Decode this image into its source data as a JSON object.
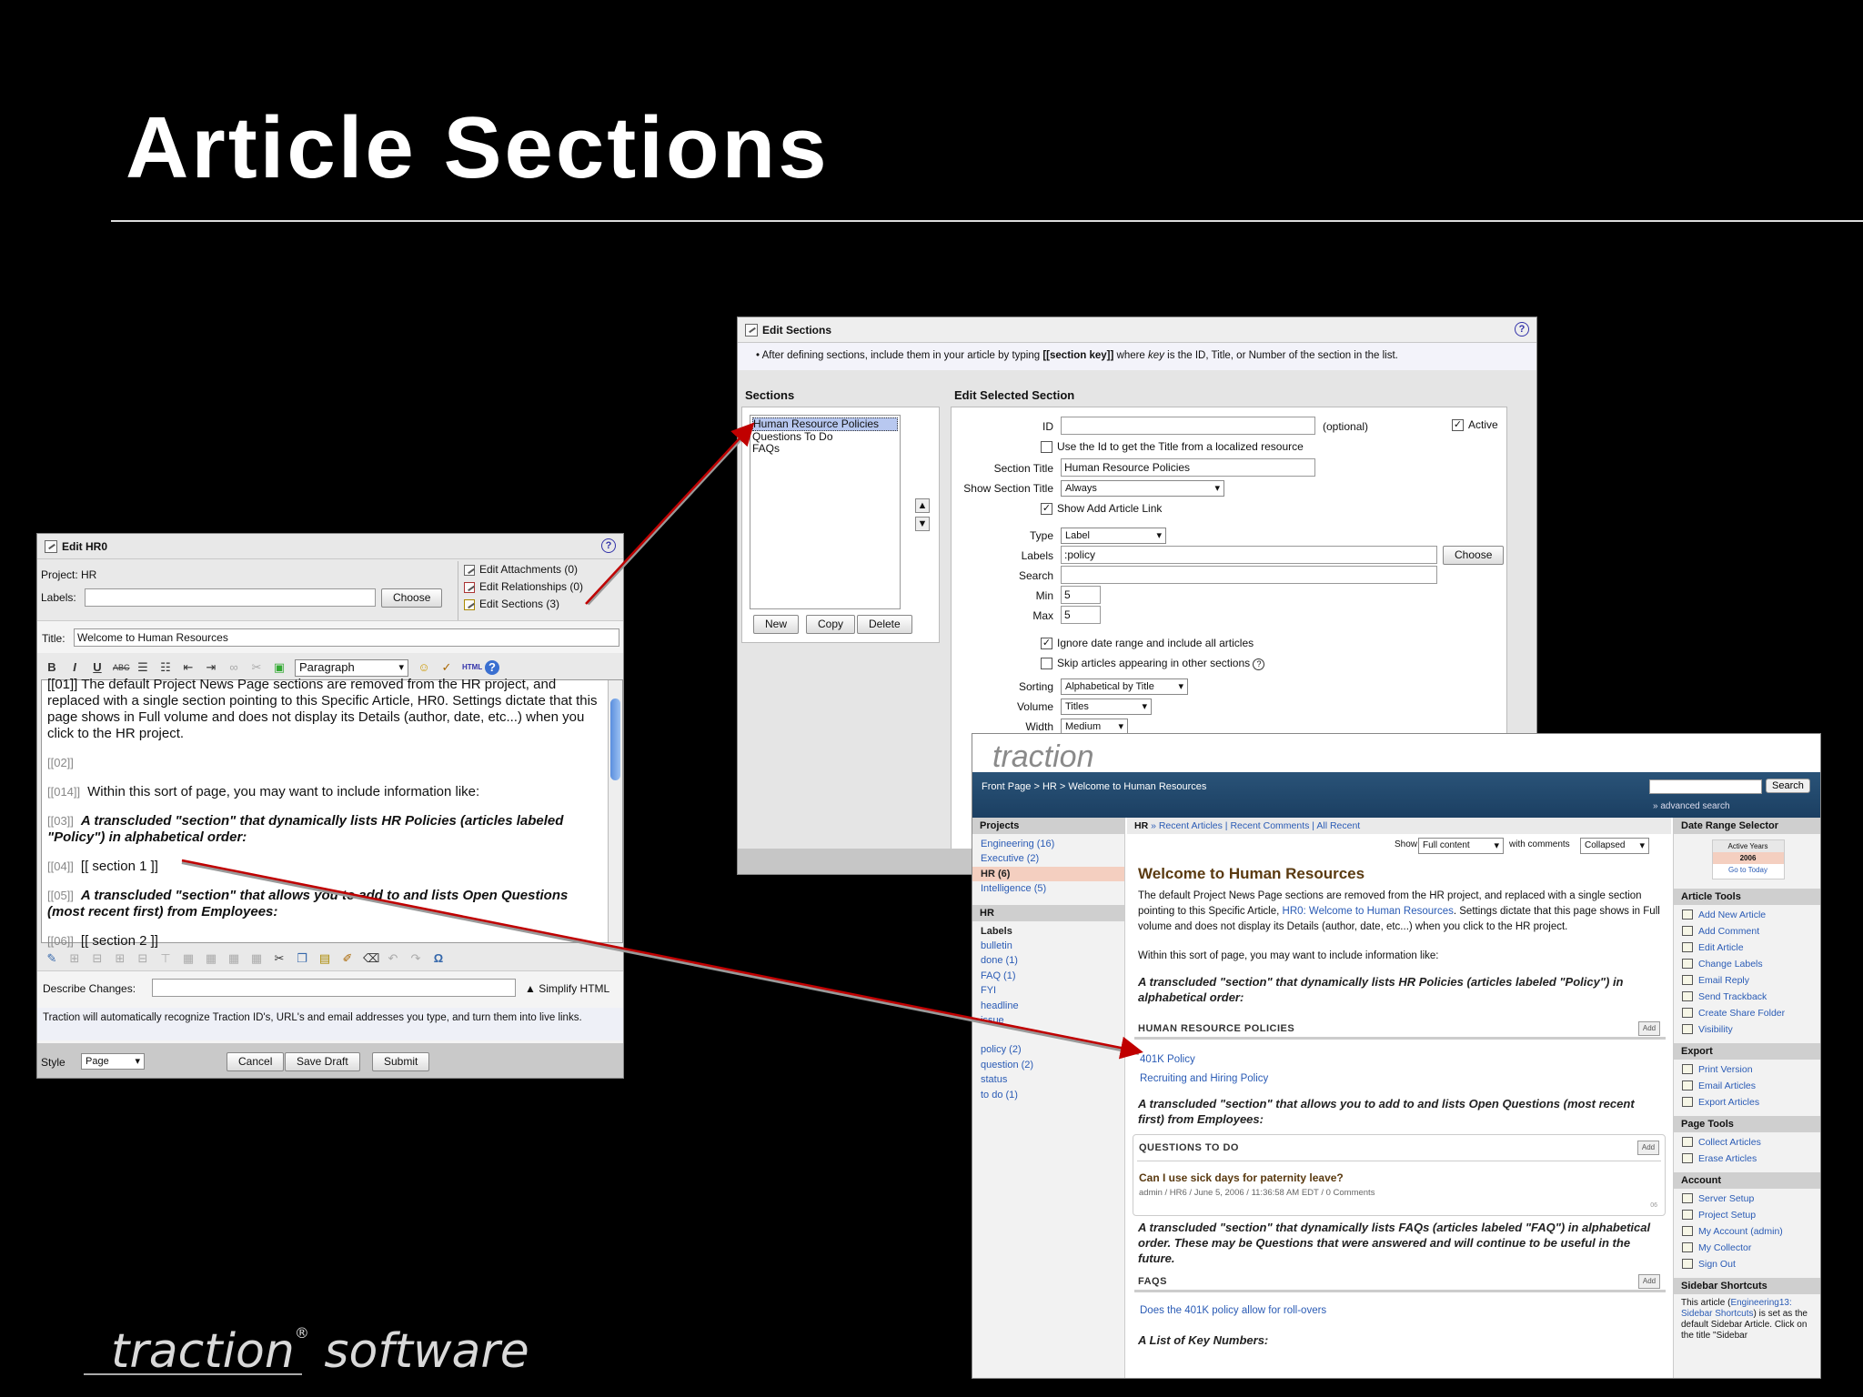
{
  "slide": {
    "title": "Article Sections",
    "logo_text": "traction",
    "logo_suffix": " software",
    "logo_reg": "®"
  },
  "edit_hr0": {
    "title": "Edit HR0",
    "project_label": "Project: HR",
    "labels_label": "Labels:",
    "choose": "Choose",
    "edit_attachments": "Edit Attachments (0)",
    "edit_relationships": "Edit Relationships (0)",
    "edit_sections": "Edit Sections (3)",
    "title_label": "Title:",
    "title_value": "Welcome to Human Resources",
    "paragraph_select": "Paragraph",
    "html_btn": "HTML",
    "content": {
      "p0": "[[01]] The default Project News Page sections are removed from the HR project, and replaced with a single section pointing to this Specific Article, HR0. Settings dictate that this page shows in Full volume and does not display its Details (author, date, etc...) when you click to the HR project.",
      "t02": "[[02]]",
      "t014": "[[014]]",
      "p014": "Within this sort of page, you may want to include information like:",
      "t03": "[[03]]",
      "p03": "A transcluded \"section\" that dynamically lists HR Policies (articles labeled \"Policy\") in alphabetical order:",
      "t04": "[[04]]",
      "p04": "[[ section 1 ]]",
      "t05": "[[05]]",
      "p05": "A transcluded \"section\" that allows you to add to and lists Open Questions (most recent first) from Employees:",
      "t06": "[[06]]",
      "p06": "[[ section 2 ]]"
    },
    "describe_label": "Describe Changes:",
    "simplify": "▲ Simplify HTML",
    "notice": "Traction will automatically recognize Traction ID's, URL's and email addresses you type, and turn them into live links.",
    "style_label": "Style",
    "style_value": "Page",
    "cancel": "Cancel",
    "save_draft": "Save Draft",
    "submit": "Submit"
  },
  "edit_sections": {
    "title": "Edit Sections",
    "hint_pre": "After defining sections, include them in your article by typing ",
    "hint_key": "[[section key]]",
    "hint_mid": " where ",
    "hint_key2": "key",
    "hint_post": " is the ID, Title, or Number of the section in the list.",
    "sections_heading": "Sections",
    "edit_selected_heading": "Edit Selected Section",
    "sections": [
      "Human Resource Policies",
      "Questions To Do",
      "FAQs"
    ],
    "new": "New",
    "copy": "Copy",
    "delete": "Delete",
    "id_label": "ID",
    "optional": "(optional)",
    "active": "Active",
    "use_id": "Use the Id to get the Title from a localized resource",
    "section_title_label": "Section Title",
    "section_title_value": "Human Resource Policies",
    "show_section_title_label": "Show Section Title",
    "show_section_title_value": "Always",
    "show_add_link": "Show Add Article Link",
    "type_label": "Type",
    "type_value": "Label",
    "labels_label": "Labels",
    "labels_value": ":policy",
    "choose": "Choose",
    "search_label": "Search",
    "min_label": "Min",
    "min_value": "5",
    "max_label": "Max",
    "max_value": "5",
    "ignore_date": "Ignore date range and include all articles",
    "skip_articles": "Skip articles appearing in other sections",
    "sorting_label": "Sorting",
    "sorting_value": "Alphabetical by Title",
    "volume_label": "Volume",
    "volume_value": "Titles",
    "width_label": "Width",
    "width_value": "Medium"
  },
  "traction_page": {
    "logo": "traction",
    "breadcrumb": "Front Page > HR > Welcome to Human Resources",
    "search_btn": "Search",
    "advanced_search": "» advanced search",
    "projects_heading": "Projects",
    "projects": [
      "Engineering (16)",
      "Executive (2)",
      "HR (6)",
      "Intelligence (5)"
    ],
    "hr_heading": "HR",
    "labels_heading": "Labels",
    "labels": [
      "bulletin",
      "done (1)",
      "FAQ (1)",
      "FYI",
      "headline",
      "issue",
      "",
      "policy (2)",
      "question (2)",
      "status",
      "to do (1)"
    ],
    "top_links_hr": "HR",
    "top_links": "» Recent Articles | Recent Comments | All Recent",
    "show_label": "Show",
    "show_value": "Full content",
    "with_comments": "with comments",
    "comments_value": "Collapsed",
    "article_title": "Welcome to Human Resources",
    "intro_pre": "The default Project News Page sections are removed from the HR project, and replaced with a single section pointing to this Specific Article, ",
    "intro_link": "HR0: Welcome to Human Resources",
    "intro_post": ". Settings dictate that this page shows in Full volume and does not display its Details (author, date, etc...) when you click to the HR project.",
    "within": "Within this sort of page, you may want to include information like:",
    "policies_intro": "A transcluded \"section\" that dynamically lists HR Policies (articles labeled \"Policy\") in alphabetical order:",
    "policies_heading": "HUMAN RESOURCE POLICIES",
    "add": "Add",
    "policies": [
      "401K Policy",
      "Recruiting and Hiring Policy"
    ],
    "questions_intro": "A transcluded \"section\" that allows you to add to and lists Open Questions (most recent first) from Employees:",
    "questions_heading": "QUESTIONS TO DO",
    "question_title": "Can I use sick days for paternity leave?",
    "question_meta": "admin / HR6 / June 5, 2006 / 11:36:58 AM EDT / 0 Comments",
    "question_num": "06",
    "faqs_intro": "A transcluded \"section\" that dynamically lists FAQs (articles labeled \"FAQ\") in alphabetical order. These may be Questions that were answered and will continue to be useful in the future.",
    "faqs_heading": "FAQS",
    "faq_item": "Does the 401K policy allow for roll-overs",
    "key_numbers": "A List of Key Numbers:",
    "date_range_heading": "Date Range Selector",
    "active_years": "Active Years",
    "year": "2006",
    "go_to_today": "Go to Today",
    "article_tools_heading": "Article Tools",
    "article_tools": [
      "Add New Article",
      "Add Comment",
      "Edit Article",
      "Change Labels",
      "Email Reply",
      "Send Trackback",
      "Create Share Folder",
      "Visibility"
    ],
    "export_heading": "Export",
    "export_tools": [
      "Print Version",
      "Email Articles",
      "Export Articles"
    ],
    "page_tools_heading": "Page Tools",
    "page_tools": [
      "Collect Articles",
      "Erase Articles"
    ],
    "account_heading": "Account",
    "account_tools": [
      "Server Setup",
      "Project Setup",
      "My Account (admin)",
      "My Collector",
      "Sign Out"
    ],
    "shortcuts_heading": "Sidebar Shortcuts",
    "shortcuts_pre": "This article (",
    "shortcuts_link": "Engineering13: Sidebar Shortcuts",
    "shortcuts_post": ") is set as the default Sidebar Article. Click on the title \"Sidebar"
  },
  "colors": {
    "background": "#000000",
    "title": "#ffffff",
    "link": "#2a5bb5",
    "traction_bar": "#1b3f62",
    "arrow": "#c00000",
    "article_title": "#5a3a10"
  }
}
